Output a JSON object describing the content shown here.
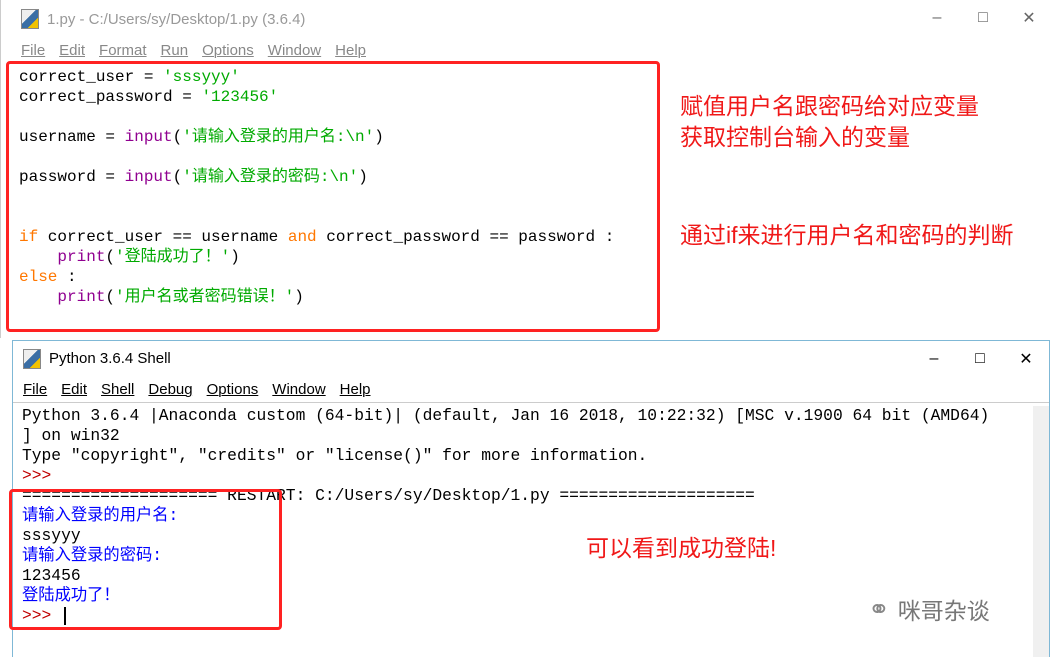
{
  "editor": {
    "title": "1.py - C:/Users/sy/Desktop/1.py (3.6.4)",
    "menu": [
      "File",
      "Edit",
      "Format",
      "Run",
      "Options",
      "Window",
      "Help"
    ],
    "code": [
      [
        [
          "t",
          "correct_user = "
        ],
        [
          "str",
          "'sssyyy'"
        ]
      ],
      [
        [
          "t",
          "correct_password = "
        ],
        [
          "str",
          "'123456'"
        ]
      ],
      [],
      [
        [
          "t",
          "username = "
        ],
        [
          "bi",
          "input"
        ],
        [
          "t",
          "("
        ],
        [
          "str",
          "'请输入登录的用户名:\\n'"
        ],
        [
          "t",
          ")"
        ]
      ],
      [],
      [
        [
          "t",
          "password = "
        ],
        [
          "bi",
          "input"
        ],
        [
          "t",
          "("
        ],
        [
          "str",
          "'请输入登录的密码:\\n'"
        ],
        [
          "t",
          ")"
        ]
      ],
      [],
      [],
      [
        [
          "kw",
          "if"
        ],
        [
          "t",
          " correct_user == username "
        ],
        [
          "kw",
          "and"
        ],
        [
          "t",
          " correct_password == password :"
        ]
      ],
      [
        [
          "t",
          "    "
        ],
        [
          "bi",
          "print"
        ],
        [
          "t",
          "("
        ],
        [
          "str",
          "'登陆成功了！'"
        ],
        [
          "t",
          ")"
        ]
      ],
      [
        [
          "kw",
          "else"
        ],
        [
          "t",
          " :"
        ]
      ],
      [
        [
          "t",
          "    "
        ],
        [
          "bi",
          "print"
        ],
        [
          "t",
          "("
        ],
        [
          "str",
          "'用户名或者密码错误！'"
        ],
        [
          "t",
          ")"
        ]
      ]
    ]
  },
  "annotations": {
    "assign": "赋值用户名跟密码给对应变量",
    "input": "获取控制台输入的变量",
    "if_check": "通过if来进行用户名和密码的判断",
    "success": "可以看到成功登陆!"
  },
  "shell": {
    "title": "Python 3.6.4 Shell",
    "menu": [
      "File",
      "Edit",
      "Shell",
      "Debug",
      "Options",
      "Window",
      "Help"
    ],
    "lines": [
      [
        [
          "t",
          "Python 3.6.4 |Anaconda custom (64-bit)| (default, Jan 16 2018, 10:22:32) [MSC v.1900 64 bit (AMD64)"
        ]
      ],
      [
        [
          "t",
          "] on win32"
        ]
      ],
      [
        [
          "t",
          "Type \"copyright\", \"credits\" or \"license()\" for more information."
        ]
      ],
      [
        [
          "pr",
          ">>>"
        ]
      ],
      [
        [
          "t",
          "==================== RESTART: C:/Users/sy/Desktop/1.py ===================="
        ]
      ],
      [
        [
          "out",
          "请输入登录的用户名:"
        ]
      ],
      [
        [
          "t",
          "sssyyy"
        ]
      ],
      [
        [
          "out",
          "请输入登录的密码:"
        ]
      ],
      [
        [
          "t",
          "123456"
        ]
      ],
      [
        [
          "out",
          "登陆成功了！"
        ]
      ],
      [
        [
          "pr",
          ">>> "
        ]
      ]
    ]
  },
  "watermark": "咪哥杂谈",
  "colors": {
    "keyword": "#ff7700",
    "builtin": "#900090",
    "string": "#00aa00",
    "output": "#0000ff",
    "prompt": "#c00000",
    "annotation": "#f01818"
  }
}
